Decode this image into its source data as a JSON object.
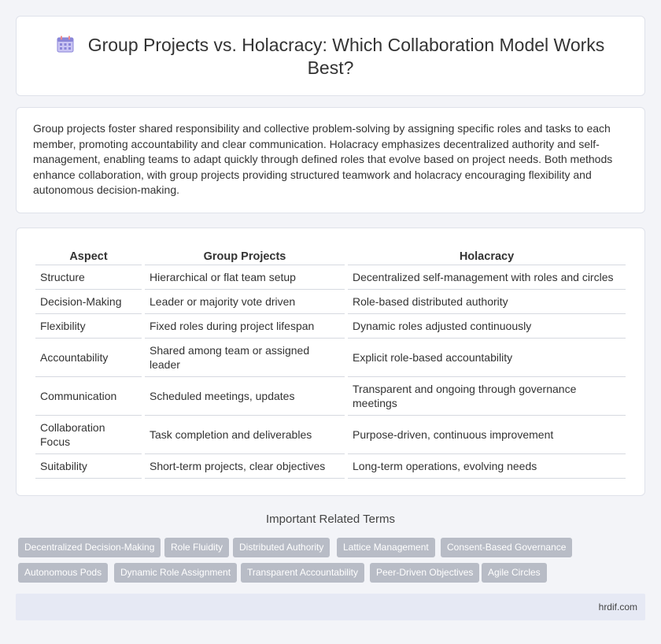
{
  "header": {
    "title": "Group Projects vs. Holacracy: Which Collaboration Model Works Best?",
    "icon": "calendar-icon"
  },
  "intro": {
    "text": "Group projects foster shared responsibility and collective problem-solving by assigning specific roles and tasks to each member, promoting accountability and clear communication. Holacracy emphasizes decentralized authority and self-management, enabling teams to adapt quickly through defined roles that evolve based on project needs. Both methods enhance collaboration, with group projects providing structured teamwork and holacracy encouraging flexibility and autonomous decision-making."
  },
  "table": {
    "headers": [
      "Aspect",
      "Group Projects",
      "Holacracy"
    ],
    "rows": [
      [
        "Structure",
        "Hierarchical or flat team setup",
        "Decentralized self-management with roles and circles"
      ],
      [
        "Decision-Making",
        "Leader or majority vote driven",
        "Role-based distributed authority"
      ],
      [
        "Flexibility",
        "Fixed roles during project lifespan",
        "Dynamic roles adjusted continuously"
      ],
      [
        "Accountability",
        "Shared among team or assigned leader",
        "Explicit role-based accountability"
      ],
      [
        "Communication",
        "Scheduled meetings, updates",
        "Transparent and ongoing through governance meetings"
      ],
      [
        "Collaboration Focus",
        "Task completion and deliverables",
        "Purpose-driven, continuous improvement"
      ],
      [
        "Suitability",
        "Short-term projects, clear objectives",
        "Long-term operations, evolving needs"
      ]
    ]
  },
  "related": {
    "heading": "Important Related Terms",
    "tags": [
      "Decentralized Decision-Making",
      "Role Fluidity",
      "Distributed Authority",
      "Lattice Management",
      "Consent-Based Governance",
      "Autonomous Pods",
      "Dynamic Role Assignment",
      "Transparent Accountability",
      "Peer-Driven Objectives",
      "Agile Circles"
    ]
  },
  "footer": {
    "site": "hrdif.com"
  },
  "colors": {
    "tag_bg": "#b8bcc6",
    "footer_bg": "#e6e9f4",
    "page_bg": "#f3f4f8"
  }
}
